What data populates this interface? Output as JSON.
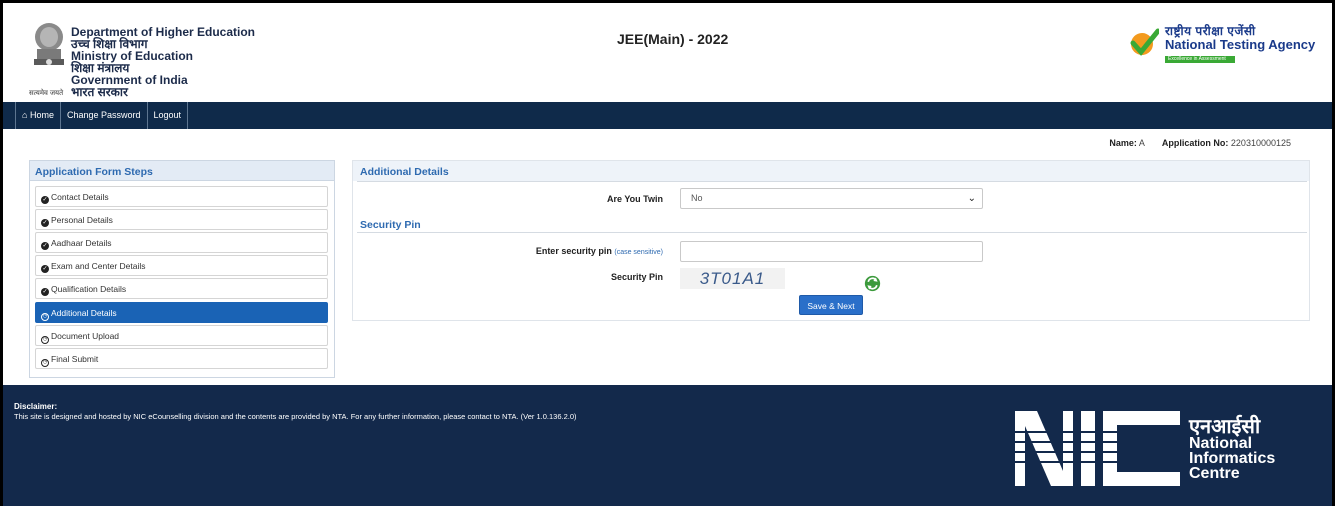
{
  "header": {
    "dept_lines": [
      "Department of Higher Education",
      "उच्च शिक्षा विभाग",
      "Ministry of Education",
      "शिक्षा मंत्रालय",
      "Government of India",
      "भारत सरकार"
    ],
    "motto": "सत्यमेव जयते",
    "title": "JEE(Main) - 2022",
    "nta_hindi": "राष्ट्रीय परीक्षा एजेंसी",
    "nta_english": "National Testing Agency",
    "nta_tagline": "Excellence in Assessment"
  },
  "nav": {
    "items": [
      {
        "label": "Home",
        "icon": "home-icon"
      },
      {
        "label": "Change Password"
      },
      {
        "label": "Logout"
      }
    ]
  },
  "user": {
    "name_label": "Name:",
    "name_value": "A",
    "app_label": "Application No:",
    "app_value": "220310000125"
  },
  "sidebar": {
    "title": "Application Form Steps",
    "steps": [
      {
        "label": "Contact Details",
        "state": "done"
      },
      {
        "label": "Personal Details",
        "state": "done"
      },
      {
        "label": "Aadhaar Details",
        "state": "done"
      },
      {
        "label": "Exam and Center Details",
        "state": "done"
      },
      {
        "label": "Qualification Details",
        "state": "done"
      },
      {
        "label": "Additional Details",
        "state": "active"
      },
      {
        "label": "Document Upload",
        "state": "pending"
      },
      {
        "label": "Final Submit",
        "state": "pending"
      }
    ]
  },
  "main": {
    "additional_title": "Additional Details",
    "twin_label": "Are You Twin",
    "twin_value": "No",
    "security_title": "Security Pin",
    "pin_label": "Enter security pin",
    "pin_hint": "(case sensitive)",
    "pin_value": "",
    "captcha_label": "Security Pin",
    "captcha_text": "3T01A1",
    "save_label": "Save & Next"
  },
  "footer": {
    "disclaimer_title": "Disclaimer:",
    "disclaimer_text": "This site is designed and hosted by NIC eCounselling division and the contents are provided by NTA. For any further information, please contact to NTA. (Ver 1.0.136.2.0)",
    "nic_hindi": "एनआईसी",
    "nic_lines": [
      "National",
      "Informatics",
      "Centre"
    ]
  },
  "colors": {
    "nav_bg": "#0f2a4a",
    "accent": "#1a63b5",
    "footer_bg": "#13294b",
    "link": "#2e6ab0"
  }
}
